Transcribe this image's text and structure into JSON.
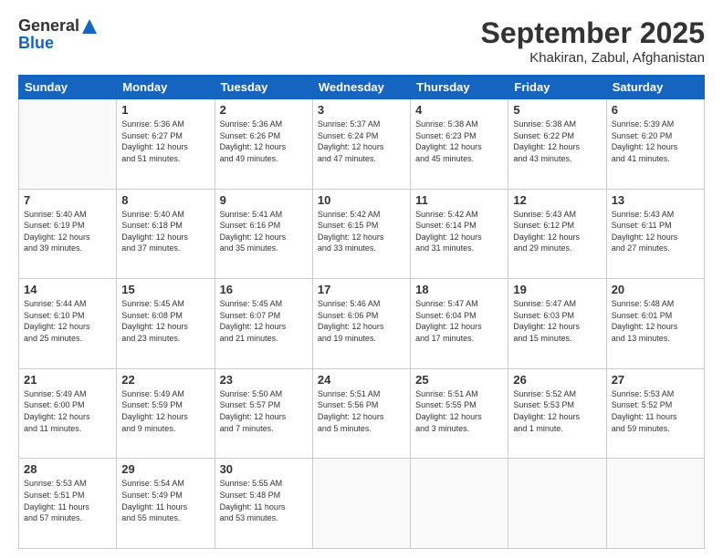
{
  "header": {
    "logo_general": "General",
    "logo_blue": "Blue",
    "month": "September 2025",
    "location": "Khakiran, Zabul, Afghanistan"
  },
  "days_of_week": [
    "Sunday",
    "Monday",
    "Tuesday",
    "Wednesday",
    "Thursday",
    "Friday",
    "Saturday"
  ],
  "weeks": [
    [
      {
        "day": "",
        "info": ""
      },
      {
        "day": "1",
        "info": "Sunrise: 5:36 AM\nSunset: 6:27 PM\nDaylight: 12 hours\nand 51 minutes."
      },
      {
        "day": "2",
        "info": "Sunrise: 5:36 AM\nSunset: 6:26 PM\nDaylight: 12 hours\nand 49 minutes."
      },
      {
        "day": "3",
        "info": "Sunrise: 5:37 AM\nSunset: 6:24 PM\nDaylight: 12 hours\nand 47 minutes."
      },
      {
        "day": "4",
        "info": "Sunrise: 5:38 AM\nSunset: 6:23 PM\nDaylight: 12 hours\nand 45 minutes."
      },
      {
        "day": "5",
        "info": "Sunrise: 5:38 AM\nSunset: 6:22 PM\nDaylight: 12 hours\nand 43 minutes."
      },
      {
        "day": "6",
        "info": "Sunrise: 5:39 AM\nSunset: 6:20 PM\nDaylight: 12 hours\nand 41 minutes."
      }
    ],
    [
      {
        "day": "7",
        "info": "Sunrise: 5:40 AM\nSunset: 6:19 PM\nDaylight: 12 hours\nand 39 minutes."
      },
      {
        "day": "8",
        "info": "Sunrise: 5:40 AM\nSunset: 6:18 PM\nDaylight: 12 hours\nand 37 minutes."
      },
      {
        "day": "9",
        "info": "Sunrise: 5:41 AM\nSunset: 6:16 PM\nDaylight: 12 hours\nand 35 minutes."
      },
      {
        "day": "10",
        "info": "Sunrise: 5:42 AM\nSunset: 6:15 PM\nDaylight: 12 hours\nand 33 minutes."
      },
      {
        "day": "11",
        "info": "Sunrise: 5:42 AM\nSunset: 6:14 PM\nDaylight: 12 hours\nand 31 minutes."
      },
      {
        "day": "12",
        "info": "Sunrise: 5:43 AM\nSunset: 6:12 PM\nDaylight: 12 hours\nand 29 minutes."
      },
      {
        "day": "13",
        "info": "Sunrise: 5:43 AM\nSunset: 6:11 PM\nDaylight: 12 hours\nand 27 minutes."
      }
    ],
    [
      {
        "day": "14",
        "info": "Sunrise: 5:44 AM\nSunset: 6:10 PM\nDaylight: 12 hours\nand 25 minutes."
      },
      {
        "day": "15",
        "info": "Sunrise: 5:45 AM\nSunset: 6:08 PM\nDaylight: 12 hours\nand 23 minutes."
      },
      {
        "day": "16",
        "info": "Sunrise: 5:45 AM\nSunset: 6:07 PM\nDaylight: 12 hours\nand 21 minutes."
      },
      {
        "day": "17",
        "info": "Sunrise: 5:46 AM\nSunset: 6:06 PM\nDaylight: 12 hours\nand 19 minutes."
      },
      {
        "day": "18",
        "info": "Sunrise: 5:47 AM\nSunset: 6:04 PM\nDaylight: 12 hours\nand 17 minutes."
      },
      {
        "day": "19",
        "info": "Sunrise: 5:47 AM\nSunset: 6:03 PM\nDaylight: 12 hours\nand 15 minutes."
      },
      {
        "day": "20",
        "info": "Sunrise: 5:48 AM\nSunset: 6:01 PM\nDaylight: 12 hours\nand 13 minutes."
      }
    ],
    [
      {
        "day": "21",
        "info": "Sunrise: 5:49 AM\nSunset: 6:00 PM\nDaylight: 12 hours\nand 11 minutes."
      },
      {
        "day": "22",
        "info": "Sunrise: 5:49 AM\nSunset: 5:59 PM\nDaylight: 12 hours\nand 9 minutes."
      },
      {
        "day": "23",
        "info": "Sunrise: 5:50 AM\nSunset: 5:57 PM\nDaylight: 12 hours\nand 7 minutes."
      },
      {
        "day": "24",
        "info": "Sunrise: 5:51 AM\nSunset: 5:56 PM\nDaylight: 12 hours\nand 5 minutes."
      },
      {
        "day": "25",
        "info": "Sunrise: 5:51 AM\nSunset: 5:55 PM\nDaylight: 12 hours\nand 3 minutes."
      },
      {
        "day": "26",
        "info": "Sunrise: 5:52 AM\nSunset: 5:53 PM\nDaylight: 12 hours\nand 1 minute."
      },
      {
        "day": "27",
        "info": "Sunrise: 5:53 AM\nSunset: 5:52 PM\nDaylight: 11 hours\nand 59 minutes."
      }
    ],
    [
      {
        "day": "28",
        "info": "Sunrise: 5:53 AM\nSunset: 5:51 PM\nDaylight: 11 hours\nand 57 minutes."
      },
      {
        "day": "29",
        "info": "Sunrise: 5:54 AM\nSunset: 5:49 PM\nDaylight: 11 hours\nand 55 minutes."
      },
      {
        "day": "30",
        "info": "Sunrise: 5:55 AM\nSunset: 5:48 PM\nDaylight: 11 hours\nand 53 minutes."
      },
      {
        "day": "",
        "info": ""
      },
      {
        "day": "",
        "info": ""
      },
      {
        "day": "",
        "info": ""
      },
      {
        "day": "",
        "info": ""
      }
    ]
  ]
}
